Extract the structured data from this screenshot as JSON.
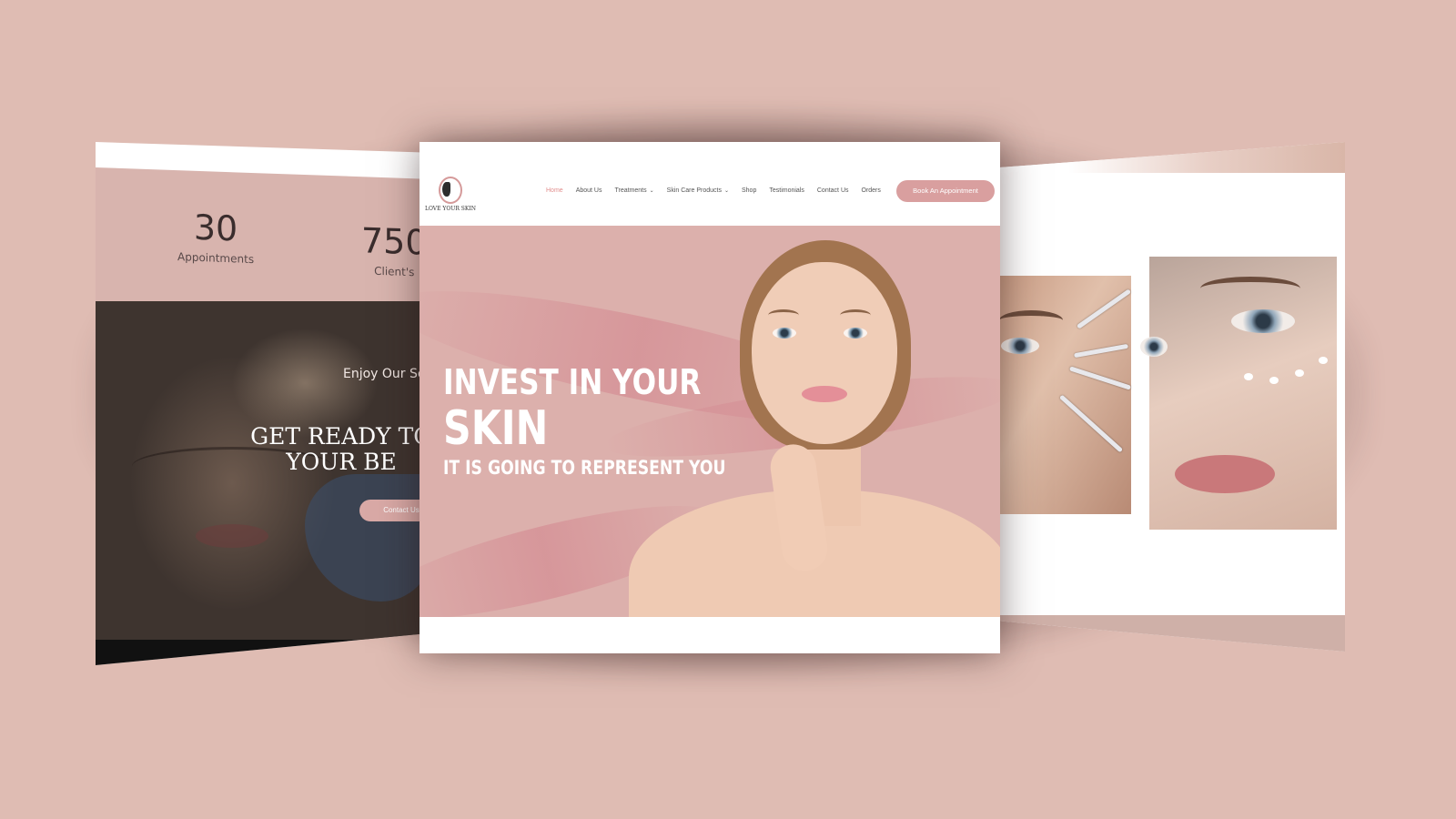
{
  "left_panel": {
    "stats": [
      {
        "number": "30",
        "label": "Appointments"
      },
      {
        "number": "750",
        "label": "Client's"
      }
    ],
    "tagline": "Enjoy Our Se",
    "headline_line1": "GET READY TO",
    "headline_line2": "YOUR BE",
    "button_label": "Contact Us"
  },
  "center_panel": {
    "logo_text": "LOVE YOUR SKIN",
    "nav": [
      {
        "label": "Home",
        "active": true,
        "has_dropdown": false
      },
      {
        "label": "About Us",
        "active": false,
        "has_dropdown": false
      },
      {
        "label": "Treatments",
        "active": false,
        "has_dropdown": true
      },
      {
        "label": "Skin Care Products",
        "active": false,
        "has_dropdown": true
      },
      {
        "label": "Shop",
        "active": false,
        "has_dropdown": false
      },
      {
        "label": "Testimonials",
        "active": false,
        "has_dropdown": false
      },
      {
        "label": "Contact Us",
        "active": false,
        "has_dropdown": false
      },
      {
        "label": "Orders",
        "active": false,
        "has_dropdown": false
      }
    ],
    "cta_button": "Book An Appointment",
    "hero": {
      "line1": "INVEST IN YOUR",
      "line2": "SKIN",
      "line3": "IT IS GOING TO REPRESENT YOU"
    }
  },
  "colors": {
    "background": "#dfbcb3",
    "accent_pink": "#d99f9f",
    "hero_bg": "#dcb0ac",
    "nav_active": "#e28d8c"
  },
  "icons": {
    "dropdown": "chevron-down-icon"
  }
}
